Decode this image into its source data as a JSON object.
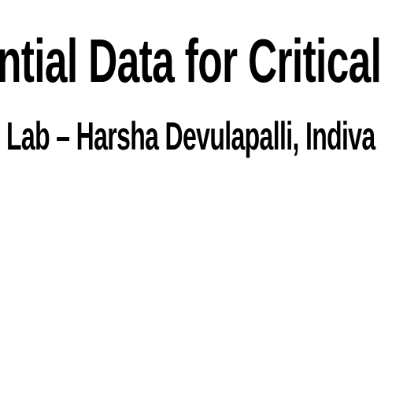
{
  "slide": {
    "title": "ntial Data for Critical",
    "subtitle": "Lab – Harsha Devulapalli, Indiva",
    "background_color": "#ffffff",
    "text_color": "#000000"
  }
}
